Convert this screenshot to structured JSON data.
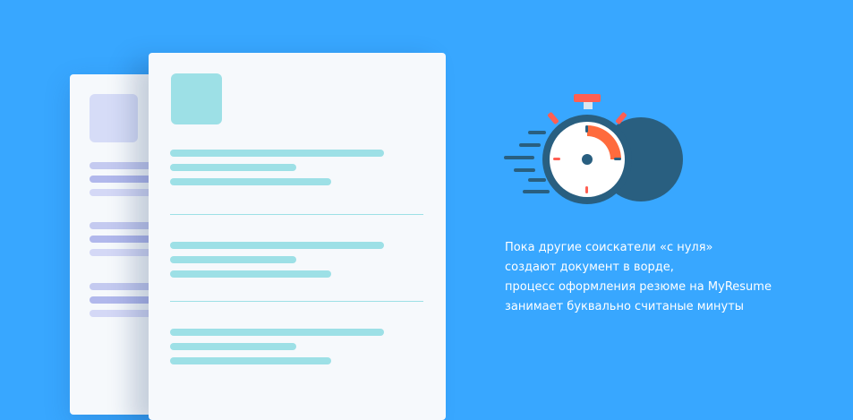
{
  "caption": {
    "lines": [
      "Пока другие соискатели «с нуля»",
      "создают документ в ворде,",
      "процесс оформления резюме на MyResume",
      "занимает буквально считаные минуты"
    ]
  },
  "icons": {
    "stopwatch": "stopwatch-icon",
    "photo_front": "photo-placeholder",
    "photo_back": "photo-placeholder"
  },
  "colors": {
    "background": "#38a7ff",
    "paper": "#f6f9fc",
    "teal_line": "#9de0e6",
    "lavender_line": "#c4caf0",
    "stopwatch_accent": "#ff6b3d",
    "stopwatch_dark": "#295f80"
  }
}
